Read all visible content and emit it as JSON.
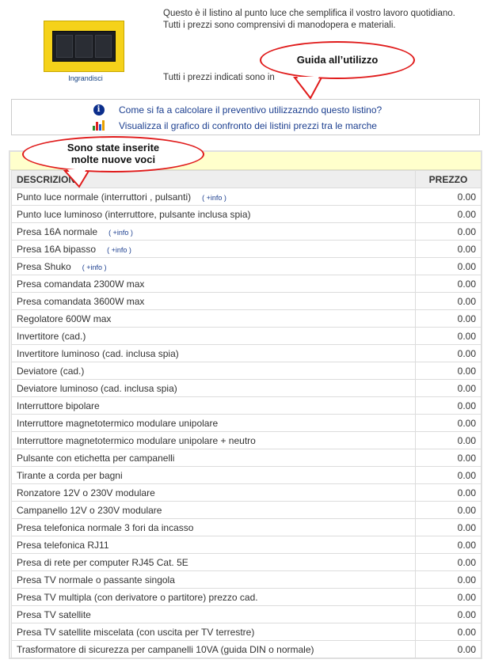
{
  "header": {
    "thumbnail_label": "Ingrandisci",
    "intro_line1": "Questo è il listino al punto luce che semplifica il vostro lavoro quotidiano.",
    "intro_line2": "Tutti i prezzi sono comprensivi di manodopera e materiali.",
    "intro_line3": "Tutti i prezzi indicati sono in"
  },
  "links": [
    {
      "icon": "info-icon",
      "label": "Come si fa a calcolare il preventivo utilizzazndo questo listino?"
    },
    {
      "icon": "bar-chart-icon",
      "label": "Visualizza il grafico di confronto dei listini prezzi tra le marche"
    }
  ],
  "callouts": {
    "guide": "Guida all’utilizzo",
    "new_items_line1": "Sono state inserite",
    "new_items_line2": "molte nuove voci"
  },
  "table": {
    "col_description": "DESCRIZIONE",
    "col_price": "PREZZO",
    "info_label": "( +info )",
    "rows": [
      {
        "desc": "Punto luce normale (interruttori , pulsanti)",
        "price": "0.00",
        "info": true
      },
      {
        "desc": "Punto luce luminoso (interruttore, pulsante inclusa spia)",
        "price": "0.00",
        "info": false
      },
      {
        "desc": "Presa 16A normale",
        "price": "0.00",
        "info": true
      },
      {
        "desc": "Presa 16A bipasso",
        "price": "0.00",
        "info": true
      },
      {
        "desc": "Presa Shuko",
        "price": "0.00",
        "info": true
      },
      {
        "desc": "Presa comandata 2300W max",
        "price": "0.00",
        "info": false
      },
      {
        "desc": "Presa comandata 3600W max",
        "price": "0.00",
        "info": false
      },
      {
        "desc": "Regolatore 600W max",
        "price": "0.00",
        "info": false
      },
      {
        "desc": "Invertitore (cad.)",
        "price": "0.00",
        "info": false
      },
      {
        "desc": "Invertitore luminoso (cad. inclusa spia)",
        "price": "0.00",
        "info": false
      },
      {
        "desc": "Deviatore (cad.)",
        "price": "0.00",
        "info": false
      },
      {
        "desc": "Deviatore luminoso (cad. inclusa spia)",
        "price": "0.00",
        "info": false
      },
      {
        "desc": "Interruttore bipolare",
        "price": "0.00",
        "info": false
      },
      {
        "desc": "Interruttore magnetotermico modulare unipolare",
        "price": "0.00",
        "info": false
      },
      {
        "desc": "Interruttore magnetotermico modulare unipolare + neutro",
        "price": "0.00",
        "info": false
      },
      {
        "desc": "Pulsante con etichetta per campanelli",
        "price": "0.00",
        "info": false
      },
      {
        "desc": "Tirante a corda per bagni",
        "price": "0.00",
        "info": false
      },
      {
        "desc": "Ronzatore 12V o 230V modulare",
        "price": "0.00",
        "info": false
      },
      {
        "desc": "Campanello 12V o 230V modulare",
        "price": "0.00",
        "info": false
      },
      {
        "desc": "Presa telefonica normale 3 fori da incasso",
        "price": "0.00",
        "info": false
      },
      {
        "desc": "Presa telefonica RJ11",
        "price": "0.00",
        "info": false
      },
      {
        "desc": "Presa di rete per computer RJ45 Cat. 5E",
        "price": "0.00",
        "info": false
      },
      {
        "desc": "Presa TV normale o passante singola",
        "price": "0.00",
        "info": false
      },
      {
        "desc": "Presa TV multipla (con derivatore o partitore) prezzo cad.",
        "price": "0.00",
        "info": false
      },
      {
        "desc": "Presa TV satellite",
        "price": "0.00",
        "info": false
      },
      {
        "desc": "Presa TV satellite miscelata (con uscita per TV terrestre)",
        "price": "0.00",
        "info": false
      },
      {
        "desc": "Trasformatore di sicurezza per campanelli 10VA (guida DIN o normale)",
        "price": "0.00",
        "info": false
      }
    ]
  },
  "colors": {
    "accent_link": "#1b3e8f",
    "callout_border": "#e01b1b",
    "band_yellow": "#ffffcc",
    "plate_yellow": "#f5d21a"
  }
}
